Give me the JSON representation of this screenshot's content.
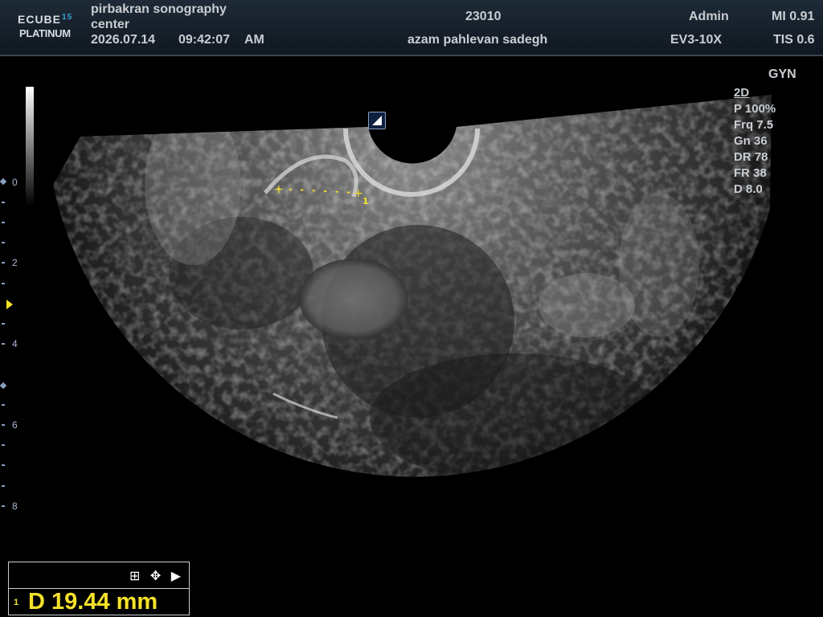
{
  "header": {
    "logo_line1": "ECUBE",
    "logo_sup": "15",
    "logo_line2": "PLATINUM",
    "institution_line1": "pirbakran sonography",
    "institution_line2": "center",
    "date": "2026.07.14",
    "time": "09:42:07",
    "ampm": "AM",
    "patient_id": "23010",
    "patient_name": "azam pahlevan sadegh",
    "operator": "Admin",
    "probe": "EV3-10X",
    "mi": "MI 0.91",
    "tis": "TIS 0.6"
  },
  "preset": "GYN",
  "imaging": {
    "mode": "2D",
    "power": "P 100%",
    "frequency": "Frq 7.5",
    "gain": "Gn 36",
    "dynamic_range": "DR 78",
    "frame_rate": "FR 38",
    "depth": "D 8.0"
  },
  "depth_scale": {
    "labels": [
      "0",
      "2",
      "4",
      "6",
      "8"
    ]
  },
  "measurement": {
    "index": "1",
    "caliper_label": "1",
    "result": "D  19.44 mm",
    "tools": "⊞ ✥ ▶"
  },
  "colors": {
    "measurement": "#f5e12a",
    "header_bg": "#1e2a38",
    "scale_marks": "#8aa0c0"
  }
}
